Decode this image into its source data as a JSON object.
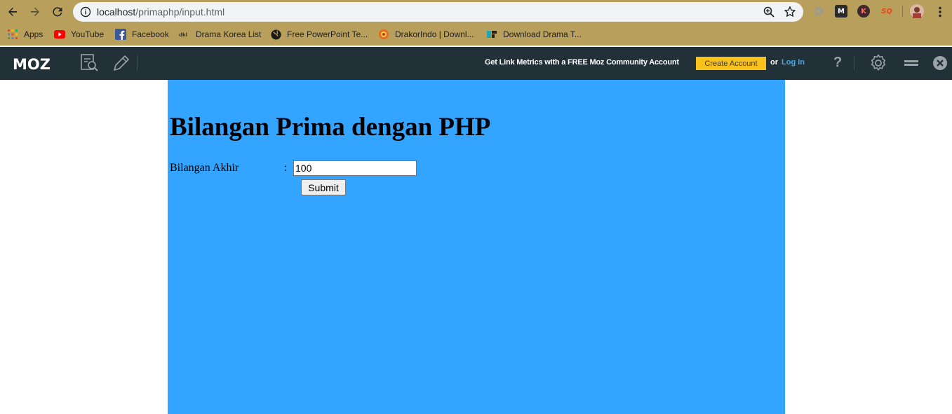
{
  "browser": {
    "url_host": "localhost",
    "url_path": "/primaphp/input.html",
    "bookmarks": [
      {
        "label": "Apps",
        "icon": "apps-grid-icon"
      },
      {
        "label": "YouTube",
        "icon": "youtube-icon"
      },
      {
        "label": "Facebook",
        "icon": "facebook-icon"
      },
      {
        "label": "Drama Korea List",
        "icon": "drama-korea-icon"
      },
      {
        "label": "Free PowerPoint Te...",
        "icon": "globe-icon"
      },
      {
        "label": "DrakorIndo | Downl...",
        "icon": "drakorindo-icon"
      },
      {
        "label": "Download Drama T...",
        "icon": "download-drama-icon"
      }
    ],
    "extensions": {
      "moz_letter": "M",
      "k_letter": "K",
      "sq_letter": "SQ"
    }
  },
  "mozbar": {
    "logo": "MOZ",
    "promo": "Get Link Metrics with a FREE Moz Community Account",
    "create_account": "Create Account",
    "or": "or",
    "login": "Log In",
    "help": "?"
  },
  "page": {
    "title": "Bilangan Prima dengan PHP",
    "label": "Bilangan Akhir",
    "colon": ":",
    "input_value": "100",
    "submit_label": "Submit"
  },
  "colors": {
    "toolbar": "#b8a05c",
    "mozbar": "#223138",
    "page_bg": "#33a4ff",
    "create_btn": "#f9c21b",
    "login_link": "#4aa8e8"
  }
}
